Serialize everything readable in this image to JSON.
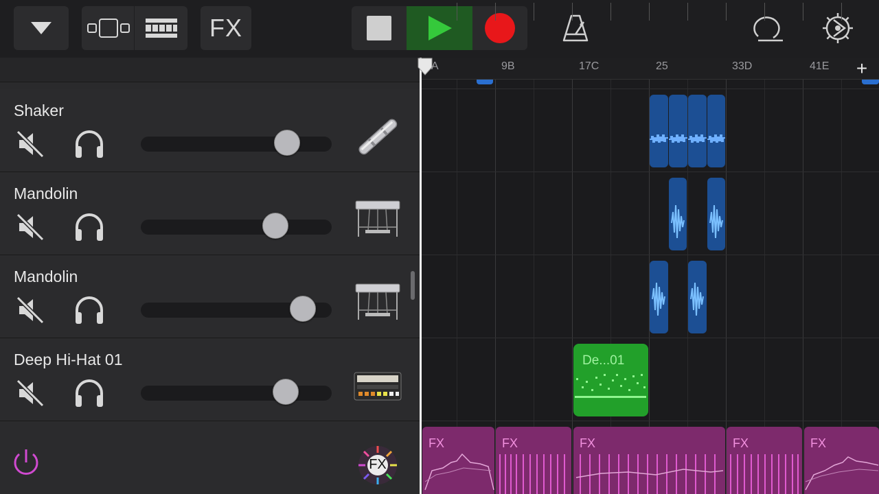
{
  "toolbar": {
    "fx_label": "FX",
    "colors": {
      "play_bg": "#1f5a22",
      "play_icon": "#35c93b",
      "record": "#e8171a"
    }
  },
  "tracks": [
    {
      "name": "Shaker",
      "instrument_icon": "shaker-icon",
      "volume": 0.77
    },
    {
      "name": "Mandolin",
      "instrument_icon": "pedal-steel-icon",
      "volume": 0.7
    },
    {
      "name": "Mandolin",
      "instrument_icon": "pedal-steel-icon",
      "volume": 0.85
    },
    {
      "name": "Deep Hi-Hat 01",
      "instrument_icon": "drum-machine-icon",
      "volume": 0.76
    }
  ],
  "ruler": {
    "labels": [
      "1A",
      "9B",
      "17C",
      "25",
      "33D",
      "41E"
    ],
    "add_label": "+"
  },
  "regions": {
    "midi_label": "De...01",
    "fx_labels": [
      "FX",
      "FX",
      "FX",
      "FX",
      "FX"
    ]
  },
  "fx_button_label": "FX",
  "colors": {
    "audio_region": "#1c4f94",
    "midi_region": "#22a02a",
    "fx_region": "#7d2a6c",
    "power": "#d04ad0"
  }
}
